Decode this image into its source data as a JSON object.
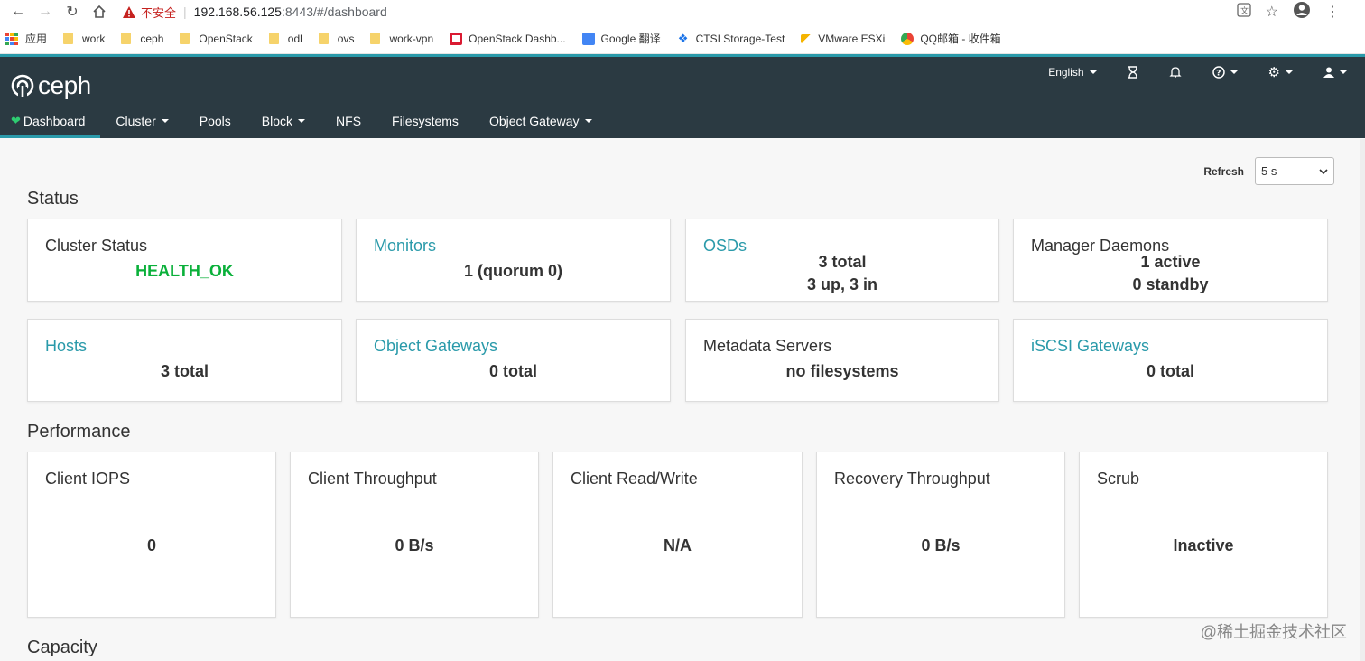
{
  "browser": {
    "insecure_label": "不安全",
    "url_host": "192.168.56.125",
    "url_path": ":8443/#/dashboard"
  },
  "bookmarks": {
    "apps": "应用",
    "items": [
      "work",
      "ceph",
      "OpenStack",
      "odl",
      "ovs",
      "work-vpn"
    ],
    "openstack_dash": "OpenStack Dashb...",
    "google": "Google 翻译",
    "ctsi": "CTSI Storage-Test",
    "vmware": "VMware ESXi",
    "qq": "QQ邮箱 - 收件箱"
  },
  "header": {
    "logo": "ceph",
    "language": "English"
  },
  "nav": {
    "dashboard": "Dashboard",
    "cluster": "Cluster",
    "pools": "Pools",
    "block": "Block",
    "nfs": "NFS",
    "filesystems": "Filesystems",
    "object_gateway": "Object Gateway"
  },
  "refresh": {
    "label": "Refresh",
    "value": "5 s"
  },
  "status": {
    "title": "Status",
    "cluster_status": {
      "title": "Cluster Status",
      "value": "HEALTH_OK"
    },
    "monitors": {
      "title": "Monitors",
      "value": "1 (quorum 0)"
    },
    "osds": {
      "title": "OSDs",
      "line1": "3 total",
      "line2": "3 up, 3 in"
    },
    "manager": {
      "title": "Manager Daemons",
      "line1": "1 active",
      "line2": "0 standby"
    },
    "hosts": {
      "title": "Hosts",
      "value": "3 total"
    },
    "object_gateways": {
      "title": "Object Gateways",
      "value": "0 total"
    },
    "metadata": {
      "title": "Metadata Servers",
      "value": "no filesystems"
    },
    "iscsi": {
      "title": "iSCSI Gateways",
      "value": "0 total"
    }
  },
  "performance": {
    "title": "Performance",
    "client_iops": {
      "title": "Client IOPS",
      "value": "0"
    },
    "client_throughput": {
      "title": "Client Throughput",
      "value": "0 B/s"
    },
    "client_rw": {
      "title": "Client Read/Write",
      "value": "N/A"
    },
    "recovery": {
      "title": "Recovery Throughput",
      "value": "0 B/s"
    },
    "scrub": {
      "title": "Scrub",
      "value": "Inactive"
    }
  },
  "capacity": {
    "title": "Capacity"
  },
  "watermark": "@稀土掘金技术社区",
  "colors": {
    "header_bg": "#2b3a42",
    "accent": "#2a9aaa",
    "health_ok": "#0ab03a"
  }
}
